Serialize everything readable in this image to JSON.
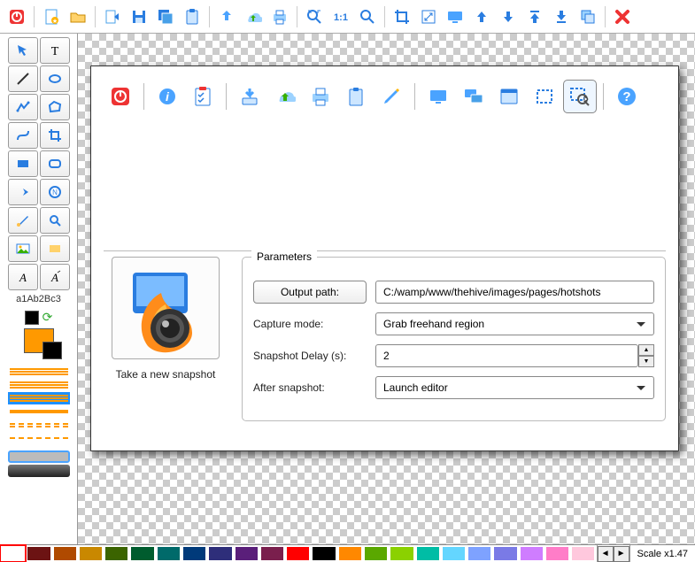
{
  "font_sample": "a1Ab2Bc3",
  "dialog": {
    "parameters_legend": "Parameters",
    "output_path_btn": "Output path:",
    "output_path_value": "C:/wamp/www/thehive/images/pages/hotshots",
    "capture_mode_label": "Capture mode:",
    "capture_mode_value": "Grab freehand region",
    "delay_label": "Snapshot Delay (s):",
    "delay_value": "2",
    "after_label": "After snapshot:",
    "after_value": "Launch editor",
    "snap_caption": "Take a new snapshot"
  },
  "palette": [
    {
      "c": "#ffffff",
      "sel": true
    },
    {
      "c": "#6c1313"
    },
    {
      "c": "#b04a00"
    },
    {
      "c": "#c98800"
    },
    {
      "c": "#3b6400"
    },
    {
      "c": "#005c2e"
    },
    {
      "c": "#006a6a"
    },
    {
      "c": "#003a7a"
    },
    {
      "c": "#2e2e7a"
    },
    {
      "c": "#5a1f7a"
    },
    {
      "c": "#7a1f4d"
    },
    {
      "c": "#ff0000"
    },
    {
      "c": "#000000"
    },
    {
      "c": "#ff8800"
    },
    {
      "c": "#5aa800"
    },
    {
      "c": "#8bd100"
    },
    {
      "c": "#00bda5"
    },
    {
      "c": "#64d6ff"
    },
    {
      "c": "#7ea2ff"
    },
    {
      "c": "#7a7ae6"
    },
    {
      "c": "#cf7dff"
    },
    {
      "c": "#ff7dc8"
    },
    {
      "c": "#ffc8dd"
    }
  ],
  "scale_label": "Scale x1.47"
}
